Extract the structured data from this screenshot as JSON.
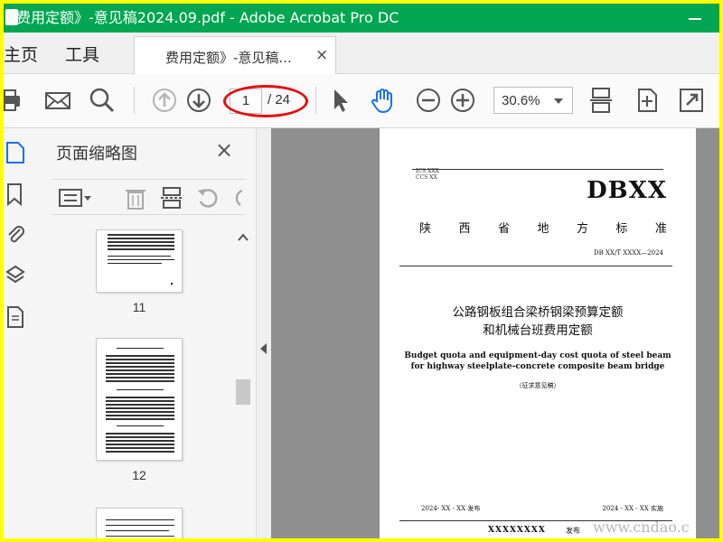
{
  "window": {
    "title": "费用定额》-意见稿2024.09.pdf - Adobe Acrobat Pro DC",
    "app_name": "Adobe Acrobat Pro DC"
  },
  "nav_tabs": {
    "home": "主页",
    "tools": "工具"
  },
  "doc_tab": {
    "label": "费用定额》-意见稿...",
    "close": "×"
  },
  "toolbar": {
    "current_page": "1",
    "total_pages": "/ 24",
    "zoom": "30.6%"
  },
  "thumb_panel": {
    "title": "页面缩略图",
    "close": "×",
    "thumbnails": [
      {
        "label": "11"
      },
      {
        "label": "12"
      }
    ]
  },
  "document": {
    "ics": "ICS   XXX",
    "ccs": "CCS   XX",
    "code": "DBXX",
    "province_chars": [
      "陕",
      "西",
      "省",
      "地",
      "方",
      "标",
      "准"
    ],
    "standard_number": "DB XX/T XXXX—2024",
    "title_cn_line1": "公路钢板组合梁桥钢梁预算定额",
    "title_cn_line2": "和机械台班费用定额",
    "title_en": "Budget quota and equipment-day cost quota of steel beam for highway steelplate-concrete composite beam bridge",
    "draft_note": "（征求意见稿）",
    "issued": "2024- XX - XX 发布",
    "effective": "2024 - XX - XX 实施",
    "publisher": "XXXXXXXX",
    "publisher_suffix": "发布"
  },
  "watermark": "www.cndao.c",
  "colors": {
    "title_bar": "#00a651",
    "frame": "#ffff00",
    "page_circle": "#e01010",
    "selected_tool": "#1a73e8"
  }
}
